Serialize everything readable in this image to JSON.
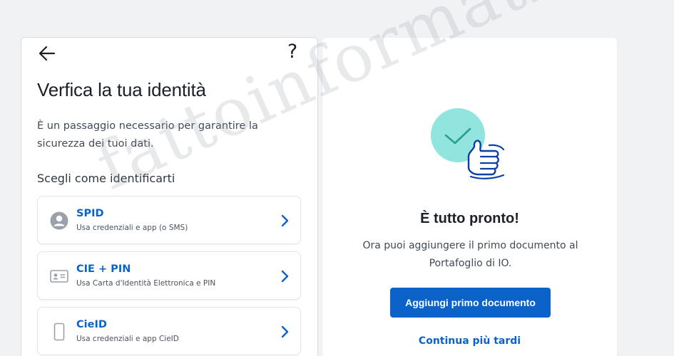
{
  "verify": {
    "title": "Verfica la tua identità",
    "subtitle": "È un passaggio necessario per garantire la sicurezza dei tuoi dati.",
    "section_title": "Scegli come identificarti",
    "help_glyph": "?",
    "methods": [
      {
        "title": "SPID",
        "desc": "Usa credenziali e app (o SMS)",
        "icon": "spid-icon"
      },
      {
        "title": "CIE + PIN",
        "desc": "Usa Carta d'Identità Elettronica e PIN",
        "icon": "id-card-icon"
      },
      {
        "title": "CieID",
        "desc": "Usa credenziali e app CieID",
        "icon": "smartphone-icon"
      }
    ]
  },
  "done": {
    "title": "È tutto pronto!",
    "desc": "Ora puoi aggiungere il primo documento al Portafoglio di IO.",
    "primary_button": "Aggiungi primo documento",
    "secondary_link": "Continua più tardi"
  },
  "watermark": "fattoinformatico",
  "colors": {
    "accent": "#0b63c9",
    "check_circle": "#7fe0d8",
    "background": "#f1f2f4"
  }
}
